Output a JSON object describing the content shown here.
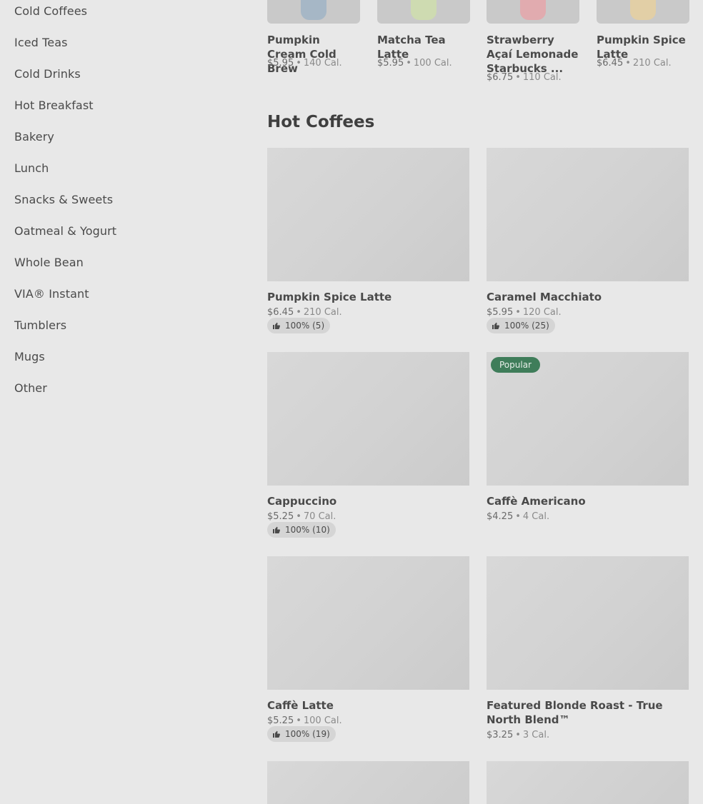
{
  "sidebar": {
    "items": [
      {
        "label": "Cold Coffees"
      },
      {
        "label": "Iced Teas"
      },
      {
        "label": "Cold Drinks"
      },
      {
        "label": "Hot Breakfast"
      },
      {
        "label": "Bakery"
      },
      {
        "label": "Lunch"
      },
      {
        "label": "Snacks & Sweets"
      },
      {
        "label": "Oatmeal & Yogurt"
      },
      {
        "label": "Whole Bean"
      },
      {
        "label": "VIA® Instant"
      },
      {
        "label": "Tumblers"
      },
      {
        "label": "Mugs"
      },
      {
        "label": "Other"
      }
    ]
  },
  "top_row": [
    {
      "name": "Pumpkin Cream Cold Brew",
      "price": "$5.95",
      "cal": "140 Cal.",
      "color": "#9ab0c4"
    },
    {
      "name": "Matcha Tea Latte",
      "price": "$5.95",
      "cal": "100 Cal.",
      "color": "#cfe0a8"
    },
    {
      "name": "Strawberry Açaí Lemonade Starbucks ...",
      "price": "$6.75",
      "cal": "110 Cal.",
      "color": "#e8a0a6"
    },
    {
      "name": "Pumpkin Spice Latte",
      "price": "$6.45",
      "cal": "210 Cal.",
      "color": "#ead09a"
    }
  ],
  "section": {
    "title": "Hot Coffees"
  },
  "products": [
    {
      "name": "Pumpkin Spice Latte",
      "price": "$6.45",
      "cal": "210 Cal.",
      "rating": "100% (5)"
    },
    {
      "name": "Caramel Macchiato",
      "price": "$5.95",
      "cal": "120 Cal.",
      "rating": "100% (25)"
    },
    {
      "name": "Cappuccino",
      "price": "$5.25",
      "cal": "70 Cal.",
      "rating": "100% (10)"
    },
    {
      "name": "Caffè Americano",
      "price": "$4.25",
      "cal": "4 Cal.",
      "badge": "Popular"
    },
    {
      "name": "Caffè Latte",
      "price": "$5.25",
      "cal": "100 Cal.",
      "rating": "100% (19)"
    },
    {
      "name": "Featured Blonde Roast - True North Blend™",
      "price": "$3.25",
      "cal": "3 Cal."
    }
  ],
  "separator": "•",
  "icons": {
    "rating": "thumbs-up-icon"
  },
  "colors": {
    "badge": "#3f7d5a",
    "background": "#e8e8e8"
  }
}
